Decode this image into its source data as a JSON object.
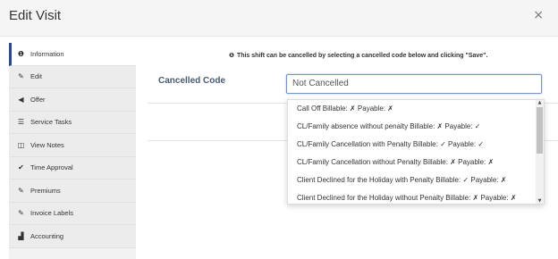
{
  "header": {
    "title": "Edit Visit",
    "close_glyph": "×"
  },
  "sidebar": {
    "items": [
      {
        "label": "Information",
        "icon": "info-icon",
        "glyph": "❶",
        "active": true
      },
      {
        "label": "Edit",
        "icon": "pencil-icon",
        "glyph": "✎"
      },
      {
        "label": "Offer",
        "icon": "megaphone-icon",
        "glyph": "◀"
      },
      {
        "label": "Service Tasks",
        "icon": "list-icon",
        "glyph": "☰"
      },
      {
        "label": "View Notes",
        "icon": "book-icon",
        "glyph": "◫"
      },
      {
        "label": "Time Approval",
        "icon": "check-icon",
        "glyph": "✔"
      },
      {
        "label": "Premiums",
        "icon": "pencil-icon",
        "glyph": "✎"
      },
      {
        "label": "Invoice Labels",
        "icon": "pencil-icon",
        "glyph": "✎"
      },
      {
        "label": "Accounting",
        "icon": "bar-chart-icon",
        "glyph": "▟"
      }
    ]
  },
  "main": {
    "info_glyph": "❶",
    "info_text": "This shift can be cancelled by selecting a cancelled code below and clicking \"Save\".",
    "field_label": "Cancelled Code",
    "select_value": "Not Cancelled",
    "options": [
      "Call Off Billable: ✗ Payable: ✗",
      "CL/Family absence without penalty Billable: ✗ Payable: ✓",
      "CL/Family Cancellation with Penalty Billable: ✓ Payable: ✓",
      "CL/Family Cancellation without Penalty Billable: ✗ Payable: ✗",
      "Client Declined for the Holiday with Penalty Billable: ✓ Payable: ✗",
      "Client Declined for the Holiday without Penalty Billable: ✗ Payable: ✗"
    ],
    "scroll_up_glyph": "▲",
    "scroll_down_glyph": "▼"
  },
  "colors": {
    "accent": "#2c4a7e",
    "header_bg": "#f5f5f5",
    "sidebar_bg": "#ececec",
    "select_border": "#7b93c7"
  }
}
